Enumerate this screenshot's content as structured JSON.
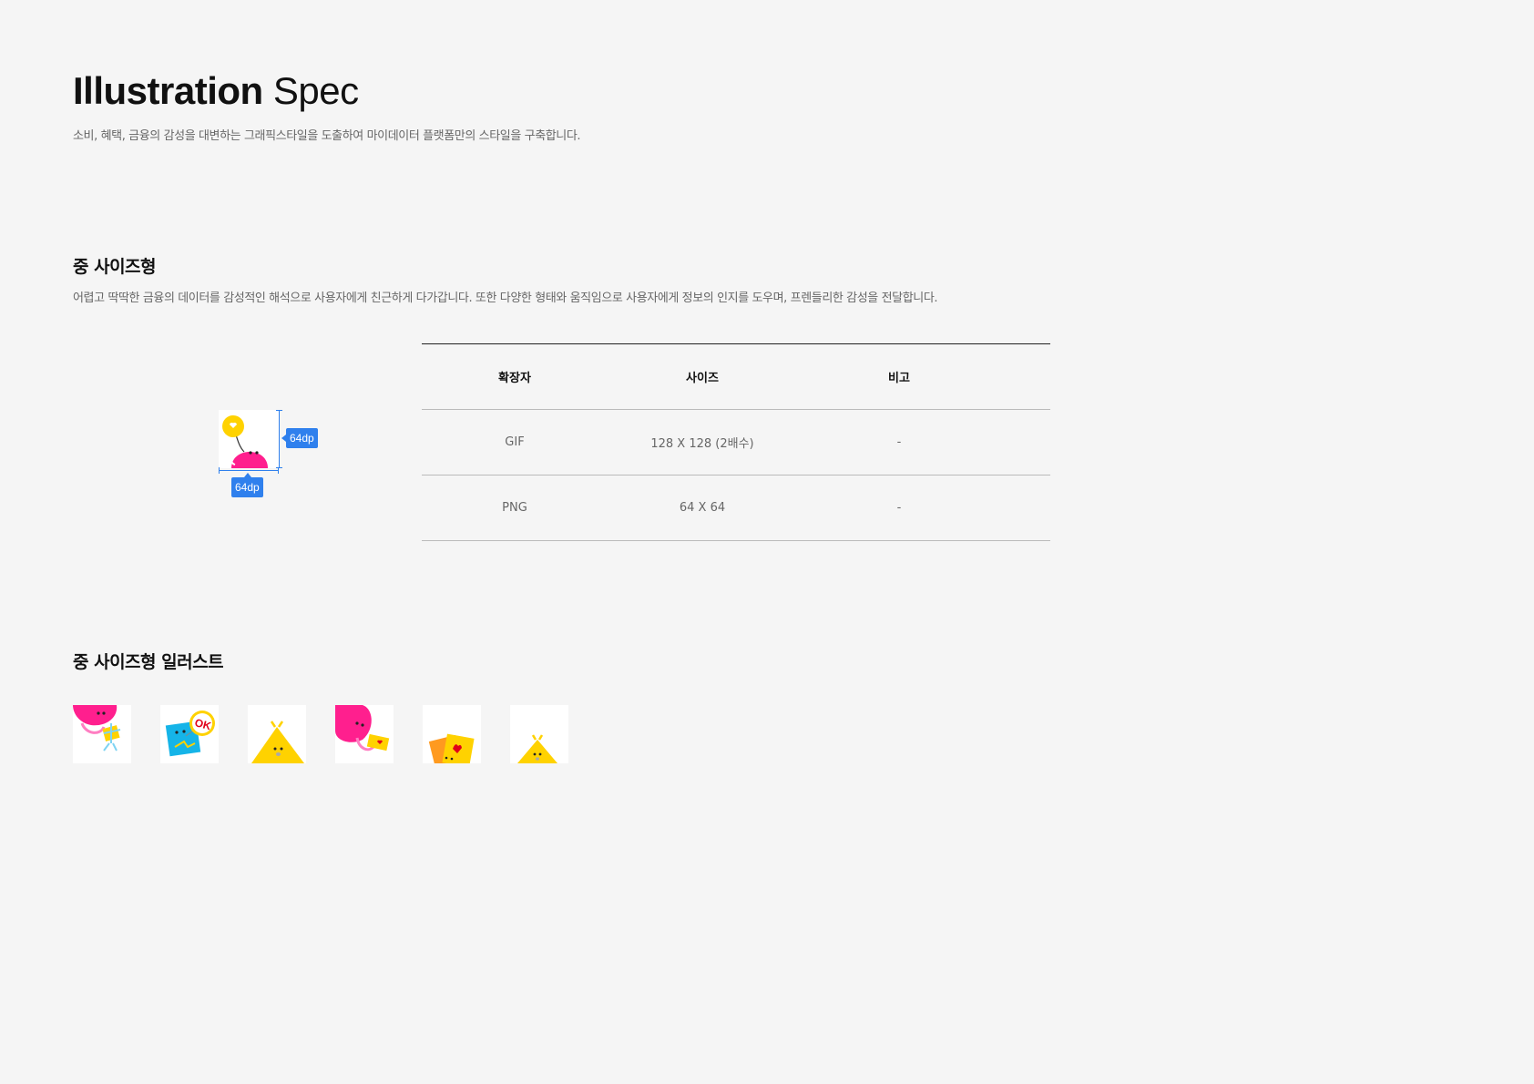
{
  "header": {
    "title_bold": "Illustration",
    "title_light": "Spec",
    "subtitle": "소비, 혜택, 금융의 감성을 대변하는 그래픽스타일을 도출하여 마이데이터 플랫폼만의 스타일을 구축합니다."
  },
  "section_medium": {
    "title": "중 사이즈형",
    "description": "어렵고 딱딱한 금융의 데이터를 감성적인 해석으로 사용자에게 친근하게 다가갑니다. 또한 다양한 형태와 움직임으로 사용자에게 정보의 인지를 도우며, 프렌들리한 감성을 전달합니다.",
    "spec_figure": {
      "icon": "pink-blob-balloon-illustration",
      "height_label": "64dp",
      "width_label": "64dp",
      "accent": "#2f80ed"
    },
    "table": {
      "headers": [
        "확장자",
        "사이즈",
        "비고"
      ],
      "rows": [
        [
          "GIF",
          "128 X 128 (2배수)",
          "-"
        ],
        [
          "PNG",
          "64 X 64",
          "-"
        ]
      ]
    }
  },
  "section_list": {
    "title": "중 사이즈형 일러스트",
    "items": [
      "pink-blob-gift-illustration",
      "blue-card-ok-badge-illustration",
      "yellow-triangle-character-illustration",
      "pink-blob-ticket-illustration",
      "orange-cards-heart-illustration",
      "yellow-triangle-small-illustration"
    ]
  },
  "colors": {
    "background": "#f5f5f5",
    "pink": "#ff1f8e",
    "yellow": "#ffd200",
    "blue": "#15b4e8",
    "orange": "#ff9a1f"
  }
}
